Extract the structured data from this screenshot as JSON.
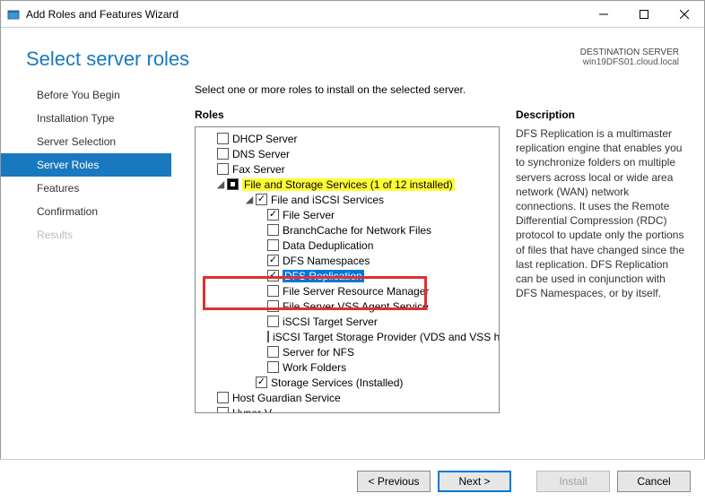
{
  "titlebar": {
    "title": "Add Roles and Features Wizard"
  },
  "header": {
    "page_title": "Select server roles",
    "dest_label": "DESTINATION SERVER",
    "dest_value": "win19DFS01.cloud.local"
  },
  "sidebar": {
    "items": [
      {
        "label": "Before You Begin"
      },
      {
        "label": "Installation Type"
      },
      {
        "label": "Server Selection"
      },
      {
        "label": "Server Roles"
      },
      {
        "label": "Features"
      },
      {
        "label": "Confirmation"
      },
      {
        "label": "Results"
      }
    ]
  },
  "main": {
    "instruction": "Select one or more roles to install on the selected server.",
    "roles_heading": "Roles",
    "desc_heading": "Description",
    "description": "DFS Replication is a multimaster replication engine that enables you to synchronize folders on multiple servers across local or wide area network (WAN) network connections. It uses the Remote Differential Compression (RDC) protocol to update only the portions of files that have changed since the last replication. DFS Replication can be used in conjunction with DFS Namespaces, or by itself.",
    "roles": {
      "dhcp": "DHCP Server",
      "dns": "DNS Server",
      "fax": "Fax Server",
      "fss": "File and Storage Services (1 of 12 installed)",
      "fis": "File and iSCSI Services",
      "fsrv": "File Server",
      "branch": "BranchCache for Network Files",
      "dedup": "Data Deduplication",
      "dfsns": "DFS Namespaces",
      "dfsrep": "DFS Replication",
      "fsrm": "File Server Resource Manager",
      "vss": "File Server VSS Agent Service",
      "iscsits": "iSCSI Target Server",
      "iscsitsp": "iSCSI Target Storage Provider (VDS and VSS hardware providers)",
      "nfs": "Server for NFS",
      "wf": "Work Folders",
      "ss": "Storage Services (Installed)",
      "hgs": "Host Guardian Service",
      "hyperv": "Hyper-V"
    }
  },
  "footer": {
    "prev": "< Previous",
    "next": "Next >",
    "install": "Install",
    "cancel": "Cancel"
  }
}
